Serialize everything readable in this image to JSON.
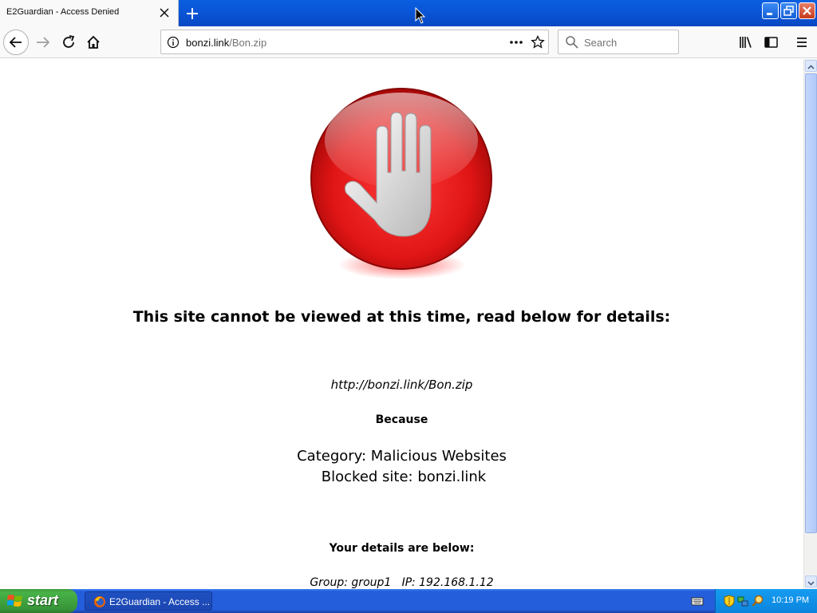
{
  "window": {
    "tab_title": "E2Guardian - Access Denied"
  },
  "toolbar": {
    "url_host": "bonzi.link",
    "url_path": "/Bon.zip",
    "search_placeholder": "Search"
  },
  "page": {
    "headline": "This site cannot be viewed at this time, read below for details:",
    "blocked_url": "http://bonzi.link/Bon.zip",
    "because_label": "Because",
    "category_line": "Category: Malicious Websites",
    "blocked_site_line": "Blocked site: bonzi.link",
    "details_heading": "Your details are below:",
    "group_line": "Group: group1   IP: 192.168.1.12"
  },
  "taskbar": {
    "start_label": "start",
    "task_item_label": "E2Guardian - Access ...",
    "clock": "10:19 PM"
  },
  "colors": {
    "titlebar_blue": "#0a56d8",
    "stop_red": "#e01515",
    "taskbar_blue": "#245edb",
    "start_green": "#3c9a3c"
  },
  "icons": {
    "tab_close": "close-icon",
    "new_tab": "plus-icon",
    "back": "arrow-left-icon",
    "forward": "arrow-right-icon",
    "reload": "reload-icon",
    "home": "home-icon",
    "site_info": "info-icon",
    "page_actions": "ellipsis-icon",
    "bookmark": "star-icon",
    "search": "search-icon",
    "library": "library-icon",
    "sidebar": "sidebar-icon",
    "menu": "hamburger-icon"
  }
}
